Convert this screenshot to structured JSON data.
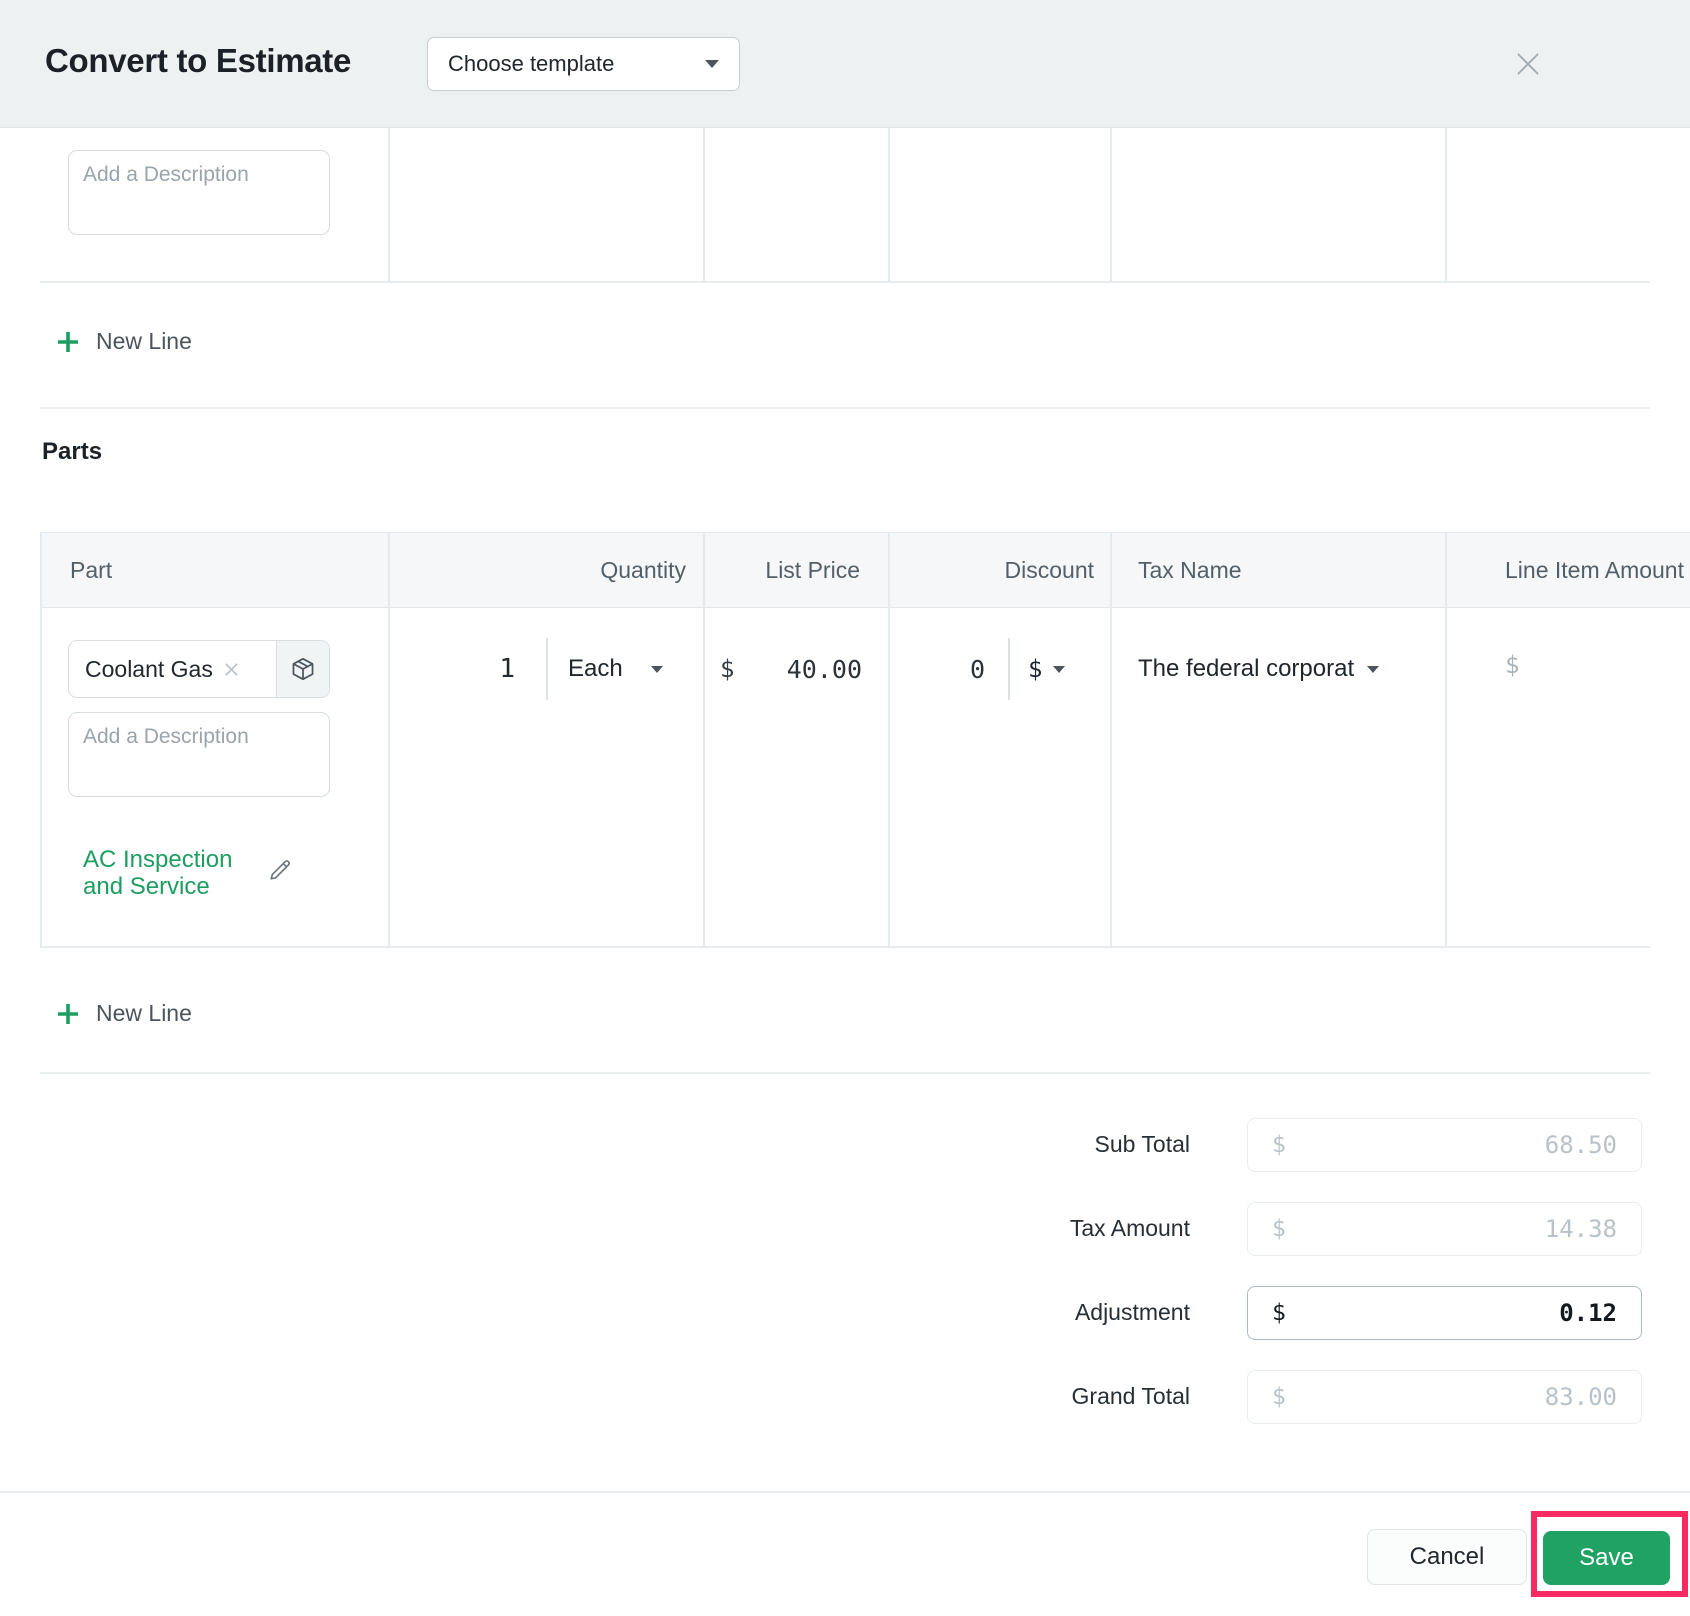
{
  "header": {
    "title": "Convert to Estimate",
    "template_label": "Choose template"
  },
  "colors": {
    "accent_green": "#1d9e61",
    "save_green": "#1fa263",
    "highlight_red": "#f72b62",
    "header_bg": "#edf1f2"
  },
  "icons": {
    "close": "x-cross",
    "chip_remove": "x-cross-small",
    "package": "3d-cube-outline",
    "edit": "pencil-outline",
    "plus": "green-plus",
    "dropdown": "down-triangle"
  },
  "services": {
    "description_placeholder": "Add a Description",
    "new_line_label": "New Line"
  },
  "parts": {
    "heading": "Parts",
    "columns": [
      "Part",
      "Quantity",
      "List Price",
      "Discount",
      "Tax Name",
      "Line Item Amount"
    ],
    "row": {
      "part_chip": "Coolant Gas",
      "description_placeholder": "Add a Description",
      "linked_service": "AC Inspection and Service",
      "quantity": "1",
      "unit": "Each",
      "list_price_currency": "$",
      "list_price": "40.00",
      "discount_value": "0",
      "discount_unit": "$",
      "tax_name": "The federal corporat",
      "line_item_currency": "$"
    },
    "new_line_label": "New Line"
  },
  "totals": {
    "sub_total": {
      "label": "Sub Total",
      "currency": "$",
      "value": "68.50"
    },
    "tax_amount": {
      "label": "Tax Amount",
      "currency": "$",
      "value": "14.38"
    },
    "adjustment": {
      "label": "Adjustment",
      "currency": "$",
      "value": "0.12"
    },
    "grand_total": {
      "label": "Grand Total",
      "currency": "$",
      "value": "83.00"
    }
  },
  "footer": {
    "cancel_label": "Cancel",
    "save_label": "Save"
  }
}
